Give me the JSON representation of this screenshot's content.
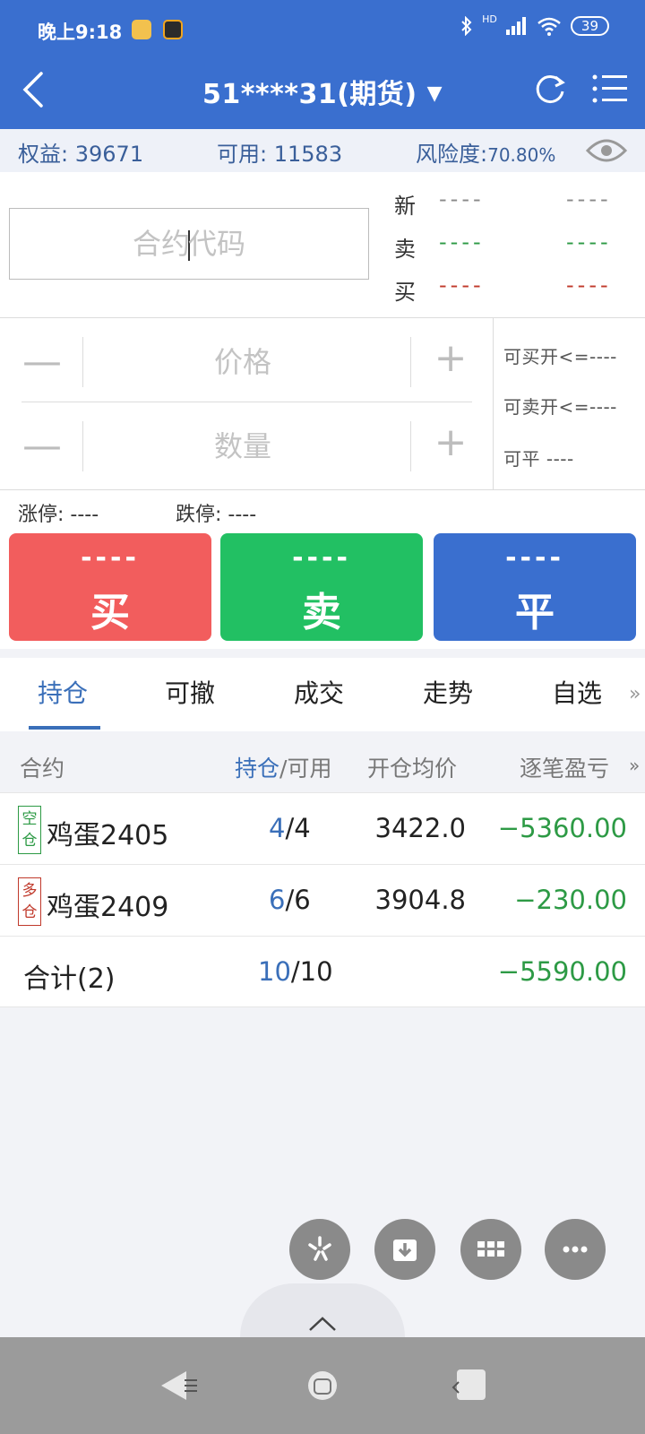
{
  "status_bar": {
    "time": "晚上9:18",
    "network": "HD",
    "battery": "39"
  },
  "nav": {
    "title": "51****31(期货)",
    "dropdown_glyph": "▼"
  },
  "account": {
    "equity_label": "权益:",
    "equity_value": "39671",
    "available_label": "可用:",
    "available_value": "11583",
    "risk_label": "风险度:",
    "risk_value": "70.80%"
  },
  "order": {
    "contract_placeholder_pre": "合约",
    "contract_placeholder_post": "代码",
    "quotes": [
      {
        "label": "新",
        "left": "----",
        "right": "----",
        "color": "#8a8a8a"
      },
      {
        "label": "卖",
        "left": "----",
        "right": "----",
        "color": "#2d9a45"
      },
      {
        "label": "买",
        "left": "----",
        "right": "----",
        "color": "#c0392b"
      }
    ],
    "price_placeholder": "价格",
    "qty_placeholder": "数量",
    "minus": "—",
    "plus": "+",
    "can_buy_open": "可买开<=----",
    "can_sell_open": "可卖开<=----",
    "can_close": "可平  ----",
    "limit_up": "涨停: ----",
    "limit_down": "跌停: ----",
    "buy": {
      "price": "----",
      "label": "买",
      "color": "#f25d5d"
    },
    "sell": {
      "price": "----",
      "label": "卖",
      "color": "#22c063"
    },
    "close": {
      "price": "----",
      "label": "平",
      "color": "#3a6fcf"
    }
  },
  "tabs": [
    "持仓",
    "可撤",
    "成交",
    "走势",
    "自选"
  ],
  "tabs_more": "»",
  "positions": {
    "headers": {
      "contract": "合约",
      "hold": "持仓",
      "slash_avail": "/可用",
      "avg_price": "开仓均价",
      "pnl": "逐笔盈亏",
      "more": "»"
    },
    "rows": [
      {
        "badge": "空仓",
        "badge_top": "空",
        "badge_bottom": "仓",
        "badge_color": "#2d9a45",
        "name": "鸡蛋2405",
        "hold": "4",
        "avail": "/4",
        "price": "3422.0",
        "pnl": "−5360.00"
      },
      {
        "badge": "多仓",
        "badge_top": "多",
        "badge_bottom": "仓",
        "badge_color": "#c0392b",
        "name": "鸡蛋2409",
        "hold": "6",
        "avail": "/6",
        "price": "3904.8",
        "pnl": "−230.00"
      }
    ],
    "total": {
      "name": "合计(2)",
      "hold": "10",
      "avail": "/10",
      "pnl": "−5590.00"
    }
  }
}
